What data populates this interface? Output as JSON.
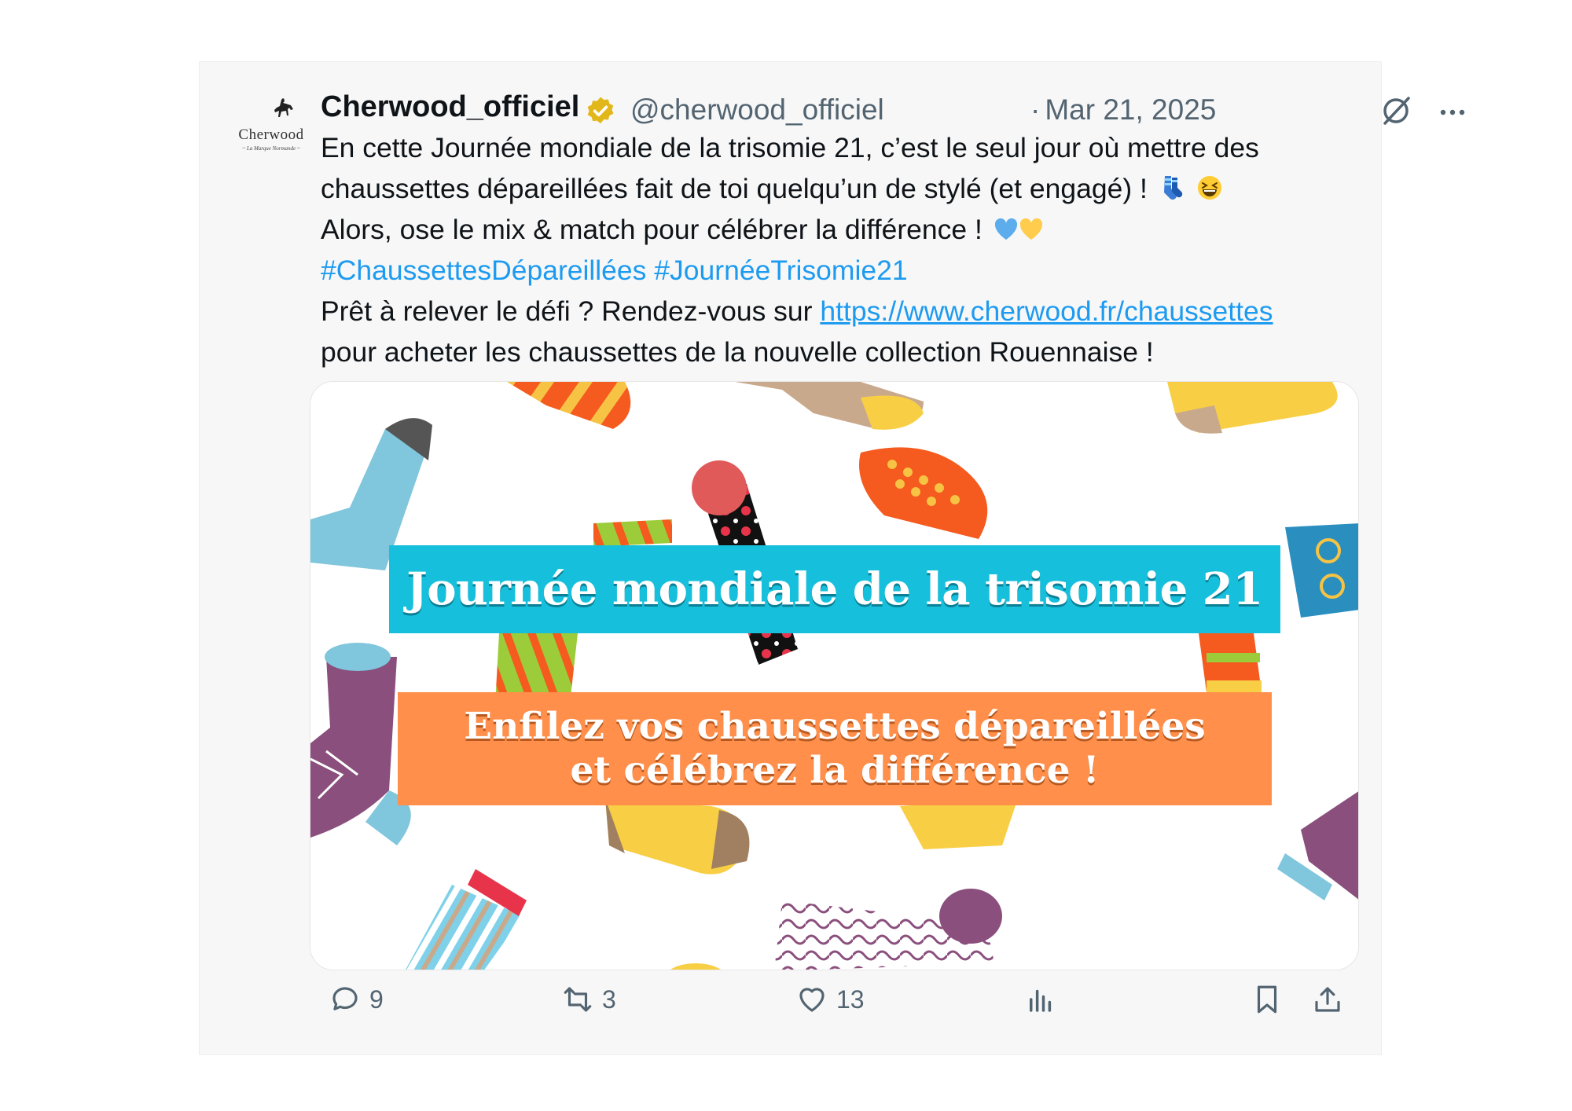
{
  "tweet": {
    "avatar": {
      "brand": "Cherwood",
      "tagline": "~ La Marque Normande ~"
    },
    "display_name": "Cherwood_officiel",
    "handle": "@cherwood_officiel",
    "separator": "·",
    "date": "Mar 21, 2025",
    "body": {
      "line1": "En cette Journée mondiale de la trisomie 21, c’est le seul jour où mettre des",
      "line2": "chaussettes dépareillées fait de toi quelqu’un de stylé (et engagé) !",
      "line3": "Alors, ose le mix & match pour célébrer la différence !",
      "hashtag1": "#ChaussettesDépareillées",
      "hashtag2": "#JournéeTrisomie21",
      "line5_prefix": "Prêt à relever le défi ? Rendez-vous sur",
      "link": "https://www.cherwood.fr/chaussettes",
      "line6": "pour acheter les chaussettes de la nouvelle collection Rouennaise !"
    },
    "emojis": [
      "socks-emoji",
      "grinning-squinting-face-emoji",
      "blue-heart-emoji",
      "yellow-heart-emoji"
    ],
    "media": {
      "banner_title": "Journée mondiale de la trisomie 21",
      "banner_sub_line1": "Enfilez vos chaussettes dépareillées",
      "banner_sub_line2": "et célébrez la différence !"
    },
    "actions": {
      "replies": "9",
      "reposts": "3",
      "likes": "13"
    },
    "colors": {
      "link": "#1d9bf0",
      "muted": "#536471",
      "verified": "#e2b719",
      "banner_blue": "#16c0dc",
      "banner_orange": "#ff8f4a"
    }
  }
}
